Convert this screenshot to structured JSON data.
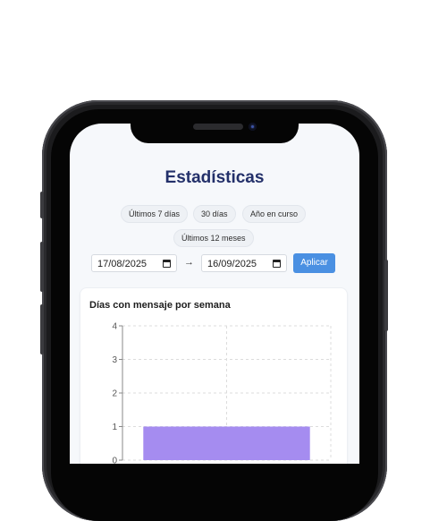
{
  "page": {
    "title": "Estadísticas"
  },
  "range_presets": [
    {
      "label": "Últimos 7 días"
    },
    {
      "label": "30 días"
    },
    {
      "label": "Año en curso"
    },
    {
      "label": "Últimos 12 meses"
    }
  ],
  "date_range": {
    "from": "17/08/2025",
    "separator": "→",
    "to": "16/09/2025",
    "apply_label": "Aplicar"
  },
  "chart_card": {
    "title": "Días con mensaje por semana"
  },
  "colors": {
    "title": "#23306a",
    "accent": "#4a90e2",
    "bar": "#a58cf0"
  },
  "icons": [
    "calendar-icon",
    "arrow-right-icon"
  ],
  "chart_data": {
    "type": "bar",
    "title": "Días con mensaje por semana",
    "xlabel": "",
    "ylabel": "",
    "ylim": [
      0,
      4
    ],
    "y_ticks": [
      "0",
      "1",
      "2",
      "3",
      "4"
    ],
    "grid": true,
    "categories": [
      ""
    ],
    "values": [
      1
    ]
  }
}
